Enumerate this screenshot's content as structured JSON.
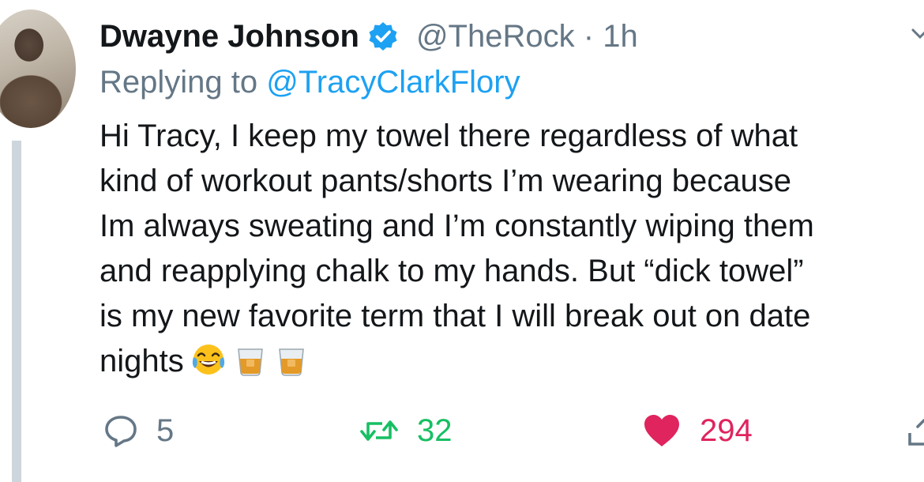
{
  "author": {
    "name": "Dwayne Johnson",
    "handle": "@TheRock",
    "separator": "·",
    "time": "1h"
  },
  "reply_to": {
    "prefix": "Replying to",
    "mention": "@TracyClarkFlory"
  },
  "tweet_lines": [
    "Hi Tracy, I keep my towel there regardless of what",
    "kind of workout pants/shorts I’m wearing because",
    "Im always sweating and I’m constantly wiping them",
    "and reapplying chalk to my hands. But “dick towel”",
    "is my new favorite term that I will break out on date",
    "nights"
  ],
  "emojis": [
    "face-with-tears-of-joy",
    "tumbler-glass",
    "tumbler-glass"
  ],
  "actions": {
    "replies": "5",
    "retweets": "32",
    "likes": "294"
  },
  "colors": {
    "link": "#1da1f2",
    "secondary_text": "#657786",
    "retweet": "#17bf63",
    "like": "#e0245e",
    "thread_line": "#cdd6dd"
  }
}
